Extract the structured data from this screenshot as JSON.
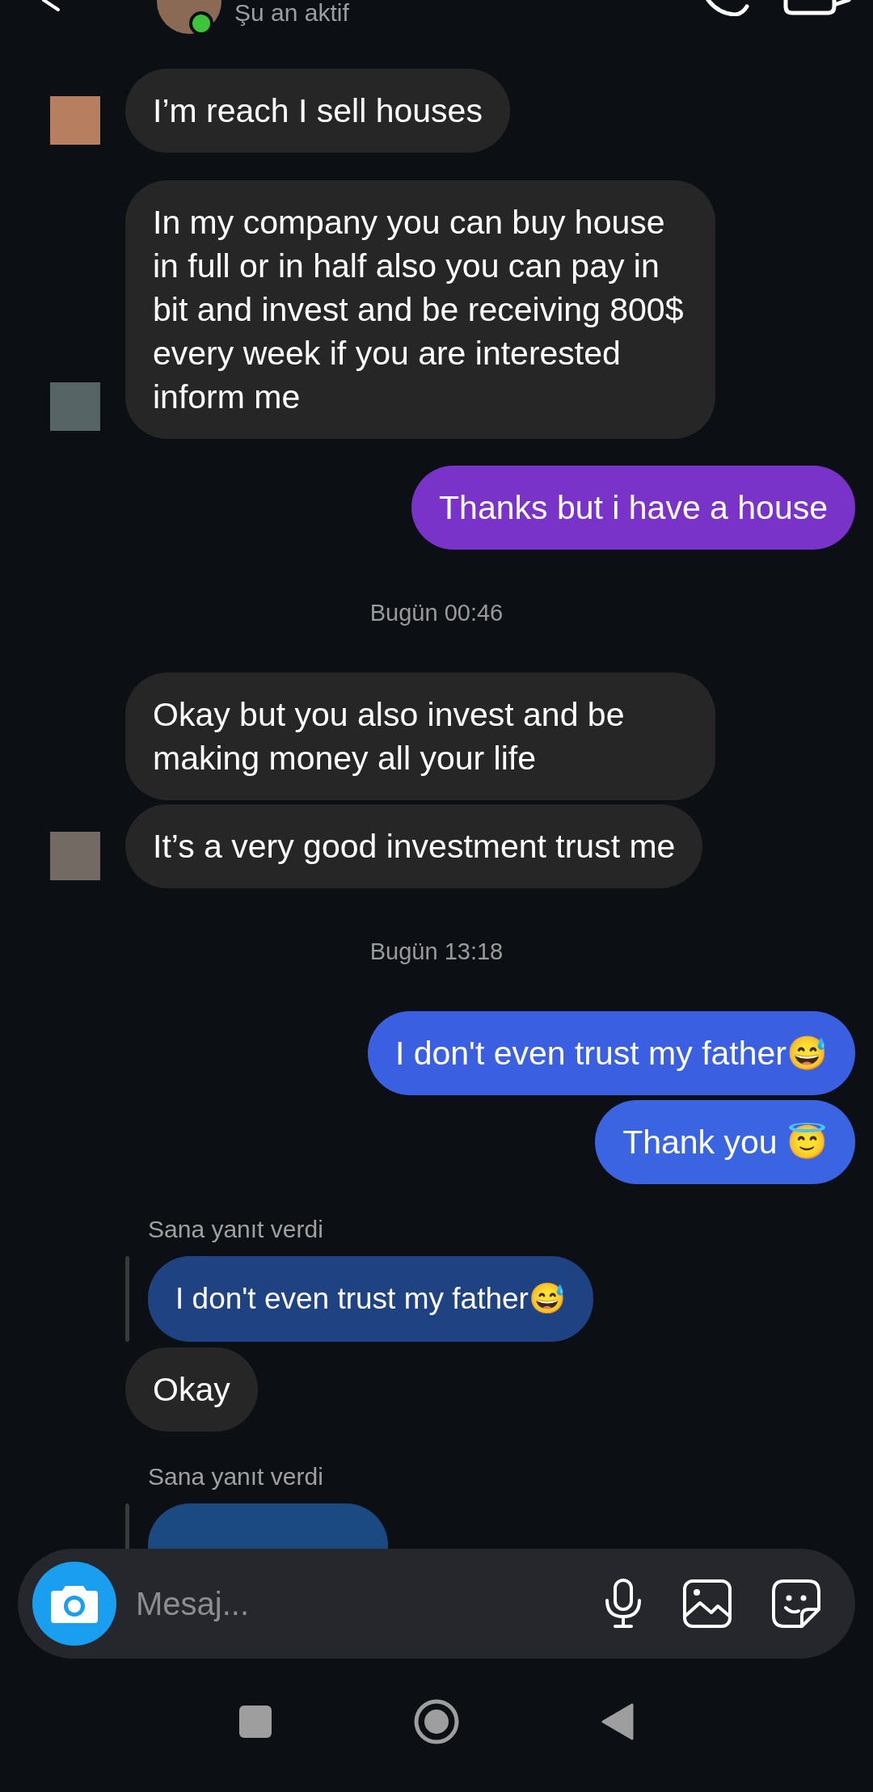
{
  "header": {
    "status": "Şu an aktif",
    "online": true
  },
  "messages": [
    {
      "kind": "incoming",
      "text": "I’m reach I sell houses",
      "color": "#b77e60"
    },
    {
      "kind": "incoming",
      "text": "In my company you can buy house in full or in half also you can pay in bit and invest and be receiving 800$  every week if you are interested inform me",
      "color": "#566466"
    },
    {
      "kind": "outgoing",
      "text": "Thanks but i have a house",
      "color": "#7a33c9"
    },
    {
      "kind": "timestamp",
      "text": "Bugün 00:46"
    },
    {
      "kind": "incoming",
      "text": "Okay but you also invest and be making money all your life"
    },
    {
      "kind": "incoming",
      "text": "It’s a very good investment trust me",
      "color": "#736a64"
    },
    {
      "kind": "timestamp",
      "text": "Bugün 13:18"
    },
    {
      "kind": "outgoing",
      "text": "I don't even trust my father😅",
      "color": "#3a5fe0"
    },
    {
      "kind": "outgoing",
      "text": "Thank you 😇",
      "color": "#3a64e2"
    },
    {
      "kind": "reply",
      "label": "Sana yanıt verdi",
      "quote": "I don't even trust my father😅",
      "color": "#1f4283"
    },
    {
      "kind": "incoming",
      "text": "Okay"
    },
    {
      "kind": "reply",
      "label": "Sana yanıt verdi",
      "color": "#1b4a82"
    }
  ],
  "composer": {
    "placeholder": "Mesaj..."
  }
}
